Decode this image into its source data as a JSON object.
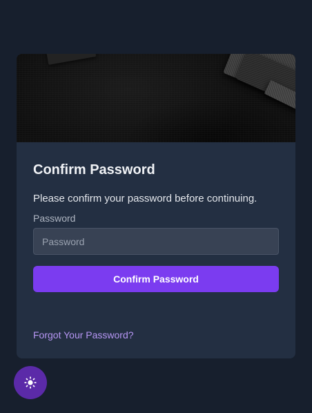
{
  "card": {
    "title": "Confirm Password",
    "instruction": "Please confirm your password before continuing.",
    "password_label": "Password",
    "password_placeholder": "Password",
    "password_value": "",
    "submit_label": "Confirm Password",
    "forgot_link": "Forgot Your Password?"
  },
  "theme_toggle": {
    "icon": "sun-icon"
  },
  "colors": {
    "page_background": "#171f2d",
    "card_background": "#232f42",
    "input_background": "#384254",
    "accent": "#7b3cf0",
    "link": "#b797f5",
    "toggle_background": "#5b2aa8"
  }
}
